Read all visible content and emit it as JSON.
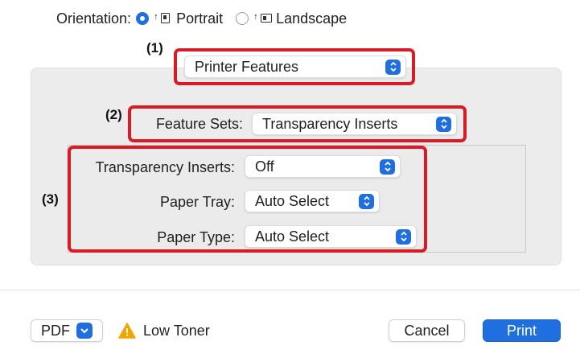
{
  "orientation": {
    "label": "Orientation:",
    "options": [
      {
        "label": "Portrait",
        "selected": true
      },
      {
        "label": "Landscape",
        "selected": false
      }
    ]
  },
  "markers": {
    "m1": "(1)",
    "m2": "(2)",
    "m3": "(3)"
  },
  "section_popup": {
    "value": "Printer Features"
  },
  "feature_sets": {
    "label": "Feature Sets:",
    "value": "Transparency Inserts"
  },
  "settings": {
    "transparency_inserts": {
      "label": "Transparency Inserts:",
      "value": "Off"
    },
    "paper_tray": {
      "label": "Paper Tray:",
      "value": "Auto Select"
    },
    "paper_type": {
      "label": "Paper Type:",
      "value": "Auto Select"
    }
  },
  "footer": {
    "pdf_label": "PDF",
    "status_icon": "warning-icon",
    "status_text": "Low Toner",
    "cancel_label": "Cancel",
    "print_label": "Print"
  },
  "colors": {
    "accent": "#1f6fe0",
    "callout": "#d81b24",
    "warning": "#f2a500"
  }
}
